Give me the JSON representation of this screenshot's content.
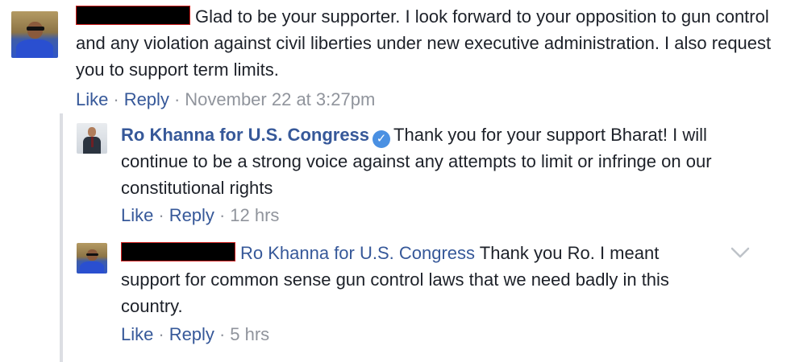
{
  "comment1": {
    "author_redacted": true,
    "text": "Glad to be your supporter. I look forward to your opposition to gun control and any violation against civil liberties under new executive administration. I also request you to support term limits.",
    "actions": {
      "like": "Like",
      "reply": "Reply",
      "separator": "·",
      "timestamp": "November 22 at 3:27pm"
    }
  },
  "reply1": {
    "author": "Ro Khanna for U.S. Congress",
    "verified_icon": "check-icon",
    "text": "Thank you for your support Bharat! I will continue to be a strong voice against any attempts to limit or infringe on our constitutional rights",
    "actions": {
      "like": "Like",
      "reply": "Reply",
      "separator": "·",
      "timestamp": "12 hrs"
    }
  },
  "reply2": {
    "author_redacted": true,
    "mention": "Ro Khanna for U.S. Congress",
    "text": "Thank you Ro. I meant support for common sense gun control laws that we need badly in this country.",
    "actions": {
      "like": "Like",
      "reply": "Reply",
      "separator": "·",
      "timestamp": "5 hrs"
    },
    "options_icon": "chevron-down-icon"
  },
  "colors": {
    "link": "#365899",
    "meta": "#90949c",
    "text": "#1d2129",
    "verified": "#4a90e2"
  }
}
